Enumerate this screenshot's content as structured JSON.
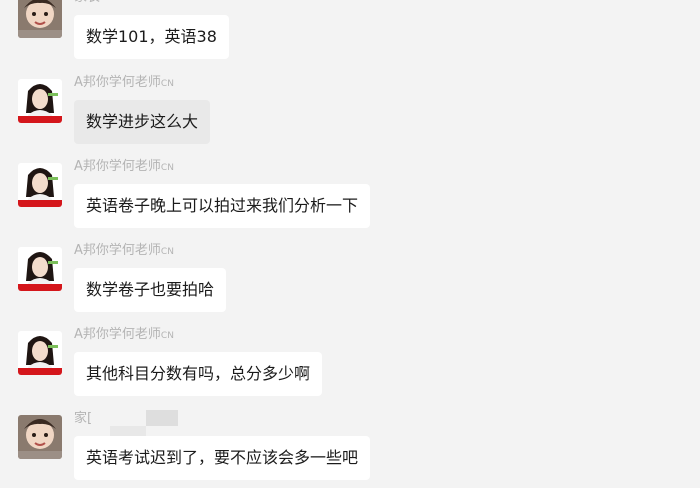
{
  "messages": [
    {
      "sender": "家长",
      "sender_suffix": "",
      "text": "数学101，英语38",
      "avatar": "parent-avatar"
    },
    {
      "sender": "A邦你学何老师",
      "sender_suffix": "CN",
      "text": "数学进步这么大",
      "avatar": "teacher-avatar"
    },
    {
      "sender": "A邦你学何老师",
      "sender_suffix": "CN",
      "text": "英语卷子晚上可以拍过来我们分析一下",
      "avatar": "teacher-avatar"
    },
    {
      "sender": "A邦你学何老师",
      "sender_suffix": "CN",
      "text": "数学卷子也要拍哈",
      "avatar": "teacher-avatar"
    },
    {
      "sender": "A邦你学何老师",
      "sender_suffix": "CN",
      "text": "其他科目分数有吗，总分多少啊",
      "avatar": "teacher-avatar"
    },
    {
      "sender": "家[",
      "sender_suffix": "",
      "text": "英语考试迟到了，要不应该会多一些吧",
      "avatar": "parent-avatar"
    }
  ],
  "colors": {
    "background": "#f3f3f3",
    "bubble": "#ffffff",
    "bubble_selected": "#e9e9e9",
    "sender_name": "#b4b4b4",
    "teacher_avatar_banner": "#d4161b"
  }
}
